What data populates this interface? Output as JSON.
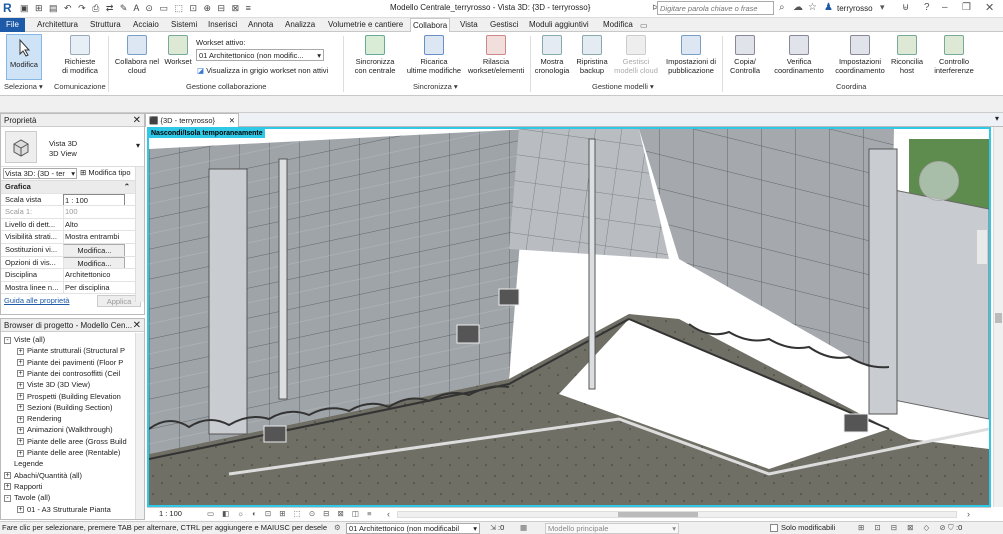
{
  "window": {
    "title": "Modello Centrale_terryrosso - Vista 3D: {3D - terryrosso}",
    "search_placeholder": "Digitare parola chiave o frase",
    "user": "terryrosso"
  },
  "menu": {
    "tabs": [
      "File",
      "Architettura",
      "Struttura",
      "Acciaio",
      "Sistemi",
      "Inserisci",
      "Annota",
      "Analizza",
      "Volumetrie e cantiere",
      "Collabora",
      "Vista",
      "Gestisci",
      "Moduli aggiuntivi",
      "Modifica"
    ],
    "active": "Collabora"
  },
  "ribbon": {
    "modifica": "Modifica",
    "richieste": "Richieste\ndi modifica",
    "collabora_cloud": "Collabora nel\ncloud",
    "workset": "Workset",
    "workset_label": "Workset attivo:",
    "workset_value": "01 Architettonico (non modific...",
    "grigio": "Visualizza in grigio workset non attivi",
    "sincronizza": "Sincronizza\ncon centrale",
    "ricarica": "Ricarica\nultime modifiche",
    "rilascia": "Rilascia\nworkset/elementi",
    "mostra": "Mostra\ncronologia",
    "ripristina": "Ripristina\nbackup",
    "gestisci": "Gestisci\nmodelli cloud",
    "impostazioni_pub": "Impostazioni di\npubblicazione",
    "copia": "Copia/\nControlla",
    "verifica": "Verifica\ncoordinamento",
    "impostazioni_coord": "Impostazioni\ncoordinamento",
    "riconcilia": "Riconcilia\nhost",
    "controllo": "Controllo\ninterferenze",
    "groups": {
      "seleziona": "Seleziona",
      "comunicazione": "Comunicazione",
      "gestione": "Gestione collaborazione",
      "sincronizza": "Sincronizza",
      "gestione_modelli": "Gestione modelli",
      "coordina": "Coordina"
    }
  },
  "properties": {
    "title": "Proprietà",
    "type_name": "Vista 3D",
    "type_sub": "3D View",
    "selector": "Vista 3D: {3D - ter",
    "edit_type": "Modifica tipo",
    "section": "Grafica",
    "rows": [
      {
        "k": "Scala vista",
        "v": "1 : 100"
      },
      {
        "k": "Scala  1:",
        "v": "100"
      },
      {
        "k": "Livello di dett...",
        "v": "Alto"
      },
      {
        "k": "Visibilità strati...",
        "v": "Mostra entrambi"
      },
      {
        "k": "Sostituzioni vi...",
        "v": "Modifica..."
      },
      {
        "k": "Opzioni di vis...",
        "v": "Modifica..."
      },
      {
        "k": "Disciplina",
        "v": "Architettonico"
      },
      {
        "k": "Mostra linee n...",
        "v": "Per disciplina"
      }
    ],
    "guide": "Guida alle proprietà",
    "apply": "Applica"
  },
  "browser": {
    "title": "Browser di progetto - Modello Cen...",
    "items": [
      {
        "label": "Viste (all)",
        "level": 0,
        "pm": "-"
      },
      {
        "label": "Piante strutturali (Structural P",
        "level": 1,
        "pm": "+"
      },
      {
        "label": "Piante dei pavimenti (Floor P",
        "level": 1,
        "pm": "+"
      },
      {
        "label": "Piante dei controsoffitti (Ceil",
        "level": 1,
        "pm": "+"
      },
      {
        "label": "Viste 3D (3D View)",
        "level": 1,
        "pm": "+"
      },
      {
        "label": "Prospetti (Building Elevation",
        "level": 1,
        "pm": "+"
      },
      {
        "label": "Sezioni (Building Section)",
        "level": 1,
        "pm": "+"
      },
      {
        "label": "Rendering",
        "level": 1,
        "pm": "+"
      },
      {
        "label": "Animazioni (Walkthrough)",
        "level": 1,
        "pm": "+"
      },
      {
        "label": "Piante delle aree (Gross Build",
        "level": 1,
        "pm": "+"
      },
      {
        "label": "Piante delle aree (Rentable)",
        "level": 1,
        "pm": "+"
      },
      {
        "label": "Legende",
        "level": 0,
        "pm": ""
      },
      {
        "label": "Abachi/Quantità (all)",
        "level": 0,
        "pm": "+"
      },
      {
        "label": "Rapporti",
        "level": 0,
        "pm": "+"
      },
      {
        "label": "Tavole (all)",
        "level": 0,
        "pm": "-"
      },
      {
        "label": "01 - A3 Strutturale Pianta",
        "level": 1,
        "pm": "+"
      }
    ]
  },
  "view": {
    "tab": "{3D - terryrosso}",
    "banner": "Nascondi/Isola temporaneamente",
    "scale": "1 : 100"
  },
  "status": {
    "hint": "Fare clic per selezionare, premere TAB per alternare, CTRL per aggiungere e MAIUSC per desele",
    "workset": "01 Architettonico (non modificabil",
    "count": ":0",
    "model": "Modello principale",
    "only_editable": "Solo modificabili",
    "filter": ":0"
  }
}
